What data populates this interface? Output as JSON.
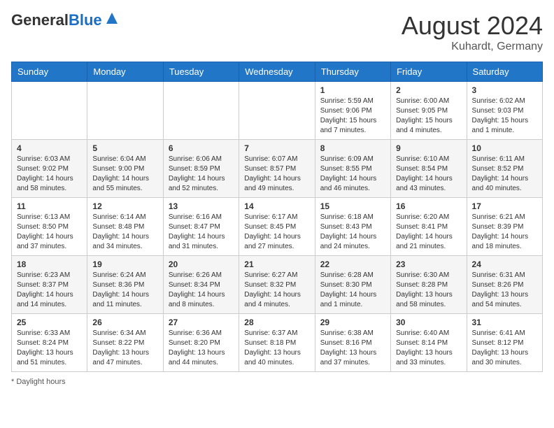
{
  "header": {
    "logo_general": "General",
    "logo_blue": "Blue",
    "month_title": "August 2024",
    "location": "Kuhardt, Germany"
  },
  "days_of_week": [
    "Sunday",
    "Monday",
    "Tuesday",
    "Wednesday",
    "Thursday",
    "Friday",
    "Saturday"
  ],
  "footer": {
    "daylight_label": "Daylight hours"
  },
  "weeks": [
    [
      {
        "day": "",
        "info": ""
      },
      {
        "day": "",
        "info": ""
      },
      {
        "day": "",
        "info": ""
      },
      {
        "day": "",
        "info": ""
      },
      {
        "day": "1",
        "info": "Sunrise: 5:59 AM\nSunset: 9:06 PM\nDaylight: 15 hours\nand 7 minutes."
      },
      {
        "day": "2",
        "info": "Sunrise: 6:00 AM\nSunset: 9:05 PM\nDaylight: 15 hours\nand 4 minutes."
      },
      {
        "day": "3",
        "info": "Sunrise: 6:02 AM\nSunset: 9:03 PM\nDaylight: 15 hours\nand 1 minute."
      }
    ],
    [
      {
        "day": "4",
        "info": "Sunrise: 6:03 AM\nSunset: 9:02 PM\nDaylight: 14 hours\nand 58 minutes."
      },
      {
        "day": "5",
        "info": "Sunrise: 6:04 AM\nSunset: 9:00 PM\nDaylight: 14 hours\nand 55 minutes."
      },
      {
        "day": "6",
        "info": "Sunrise: 6:06 AM\nSunset: 8:59 PM\nDaylight: 14 hours\nand 52 minutes."
      },
      {
        "day": "7",
        "info": "Sunrise: 6:07 AM\nSunset: 8:57 PM\nDaylight: 14 hours\nand 49 minutes."
      },
      {
        "day": "8",
        "info": "Sunrise: 6:09 AM\nSunset: 8:55 PM\nDaylight: 14 hours\nand 46 minutes."
      },
      {
        "day": "9",
        "info": "Sunrise: 6:10 AM\nSunset: 8:54 PM\nDaylight: 14 hours\nand 43 minutes."
      },
      {
        "day": "10",
        "info": "Sunrise: 6:11 AM\nSunset: 8:52 PM\nDaylight: 14 hours\nand 40 minutes."
      }
    ],
    [
      {
        "day": "11",
        "info": "Sunrise: 6:13 AM\nSunset: 8:50 PM\nDaylight: 14 hours\nand 37 minutes."
      },
      {
        "day": "12",
        "info": "Sunrise: 6:14 AM\nSunset: 8:48 PM\nDaylight: 14 hours\nand 34 minutes."
      },
      {
        "day": "13",
        "info": "Sunrise: 6:16 AM\nSunset: 8:47 PM\nDaylight: 14 hours\nand 31 minutes."
      },
      {
        "day": "14",
        "info": "Sunrise: 6:17 AM\nSunset: 8:45 PM\nDaylight: 14 hours\nand 27 minutes."
      },
      {
        "day": "15",
        "info": "Sunrise: 6:18 AM\nSunset: 8:43 PM\nDaylight: 14 hours\nand 24 minutes."
      },
      {
        "day": "16",
        "info": "Sunrise: 6:20 AM\nSunset: 8:41 PM\nDaylight: 14 hours\nand 21 minutes."
      },
      {
        "day": "17",
        "info": "Sunrise: 6:21 AM\nSunset: 8:39 PM\nDaylight: 14 hours\nand 18 minutes."
      }
    ],
    [
      {
        "day": "18",
        "info": "Sunrise: 6:23 AM\nSunset: 8:37 PM\nDaylight: 14 hours\nand 14 minutes."
      },
      {
        "day": "19",
        "info": "Sunrise: 6:24 AM\nSunset: 8:36 PM\nDaylight: 14 hours\nand 11 minutes."
      },
      {
        "day": "20",
        "info": "Sunrise: 6:26 AM\nSunset: 8:34 PM\nDaylight: 14 hours\nand 8 minutes."
      },
      {
        "day": "21",
        "info": "Sunrise: 6:27 AM\nSunset: 8:32 PM\nDaylight: 14 hours\nand 4 minutes."
      },
      {
        "day": "22",
        "info": "Sunrise: 6:28 AM\nSunset: 8:30 PM\nDaylight: 14 hours\nand 1 minute."
      },
      {
        "day": "23",
        "info": "Sunrise: 6:30 AM\nSunset: 8:28 PM\nDaylight: 13 hours\nand 58 minutes."
      },
      {
        "day": "24",
        "info": "Sunrise: 6:31 AM\nSunset: 8:26 PM\nDaylight: 13 hours\nand 54 minutes."
      }
    ],
    [
      {
        "day": "25",
        "info": "Sunrise: 6:33 AM\nSunset: 8:24 PM\nDaylight: 13 hours\nand 51 minutes."
      },
      {
        "day": "26",
        "info": "Sunrise: 6:34 AM\nSunset: 8:22 PM\nDaylight: 13 hours\nand 47 minutes."
      },
      {
        "day": "27",
        "info": "Sunrise: 6:36 AM\nSunset: 8:20 PM\nDaylight: 13 hours\nand 44 minutes."
      },
      {
        "day": "28",
        "info": "Sunrise: 6:37 AM\nSunset: 8:18 PM\nDaylight: 13 hours\nand 40 minutes."
      },
      {
        "day": "29",
        "info": "Sunrise: 6:38 AM\nSunset: 8:16 PM\nDaylight: 13 hours\nand 37 minutes."
      },
      {
        "day": "30",
        "info": "Sunrise: 6:40 AM\nSunset: 8:14 PM\nDaylight: 13 hours\nand 33 minutes."
      },
      {
        "day": "31",
        "info": "Sunrise: 6:41 AM\nSunset: 8:12 PM\nDaylight: 13 hours\nand 30 minutes."
      }
    ]
  ]
}
